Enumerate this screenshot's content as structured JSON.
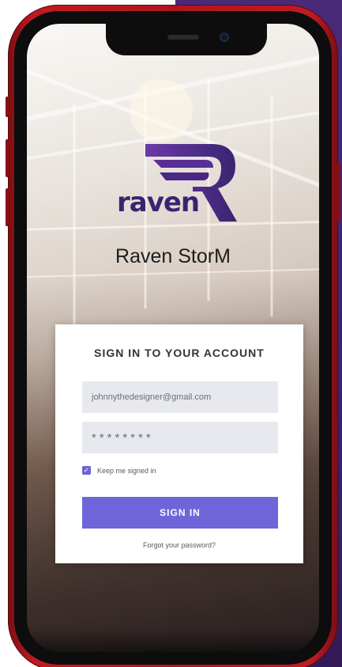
{
  "app": {
    "logo_text": "raven",
    "name": "Raven StorM"
  },
  "login": {
    "title": "SIGN IN TO YOUR ACCOUNT",
    "email_value": "johnnythedesigner@gmail.com",
    "password_value": "********",
    "keep_signed_in_label": "Keep me signed in",
    "keep_signed_in_checked": true,
    "signin_label": "SIGN IN",
    "forgot_label": "Forgot your password?"
  },
  "colors": {
    "brand_purple": "#3a2470",
    "button": "#7065d8",
    "phone_body": "#c11a22",
    "side_panel": "#4a2a78"
  },
  "icons": {
    "checkbox": "check-icon",
    "camera": "camera-icon",
    "logo": "raven-wing-logo"
  }
}
